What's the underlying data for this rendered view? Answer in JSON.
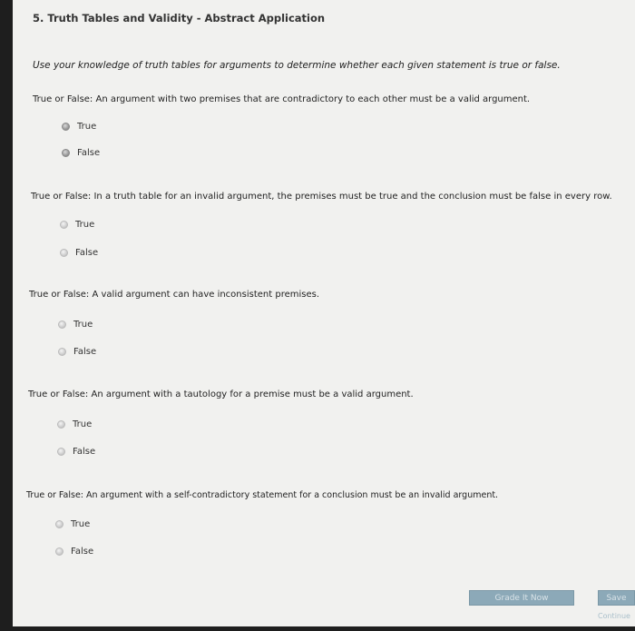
{
  "title": "5. Truth Tables and Validity - Abstract Application",
  "instructions": "Use your knowledge of truth tables for arguments to determine whether each given statement is true or false.",
  "questions": [
    {
      "text": "True or False: An argument with two premises that are contradictory to each other must be a valid argument.",
      "options": [
        "True",
        "False"
      ]
    },
    {
      "text": "True or False: In a truth table for an invalid argument, the premises must be true and the conclusion must be false in every row.",
      "options": [
        "True",
        "False"
      ]
    },
    {
      "text": "True or False: A valid argument can have inconsistent premises.",
      "options": [
        "True",
        "False"
      ]
    },
    {
      "text": "True or False: An argument with a tautology for a premise must be a valid argument.",
      "options": [
        "True",
        "False"
      ]
    },
    {
      "text": "True or False: An argument with a self-contradictory statement for a conclusion must be an invalid argument.",
      "options": [
        "True",
        "False"
      ]
    }
  ],
  "buttons": {
    "grade": "Grade It Now",
    "save": "Save",
    "continue": "Continue"
  }
}
